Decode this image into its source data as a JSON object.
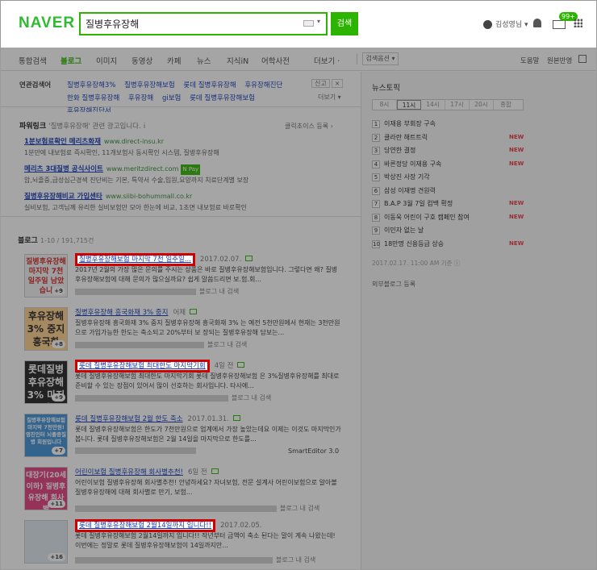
{
  "header": {
    "logo": "NAVER",
    "search_value": "질병후유장해",
    "search_button": "검색",
    "user_name": "김성영님 ▾",
    "mail_badge": "99+"
  },
  "tabs": {
    "items": [
      "통합검색",
      "블로그",
      "이미지",
      "동영상",
      "카페",
      "뉴스",
      "지식iN",
      "어학사전",
      "더보기 ·"
    ],
    "search_options": "검색옵션 ▾",
    "help": "도움말",
    "source_view": "원본반영"
  },
  "related": {
    "label": "연관검색어",
    "links": [
      "질병후유장해3%",
      "질병후유장해보험",
      "롯데 질병후유장해",
      "후유장해진단",
      "한화 질병후유장해",
      "후유장해",
      "gi보험",
      "롯데 질병후유장해보험",
      "후유장해진단서"
    ],
    "report": "신고",
    "close": "×",
    "more": "더보기 ▾"
  },
  "powerlink": {
    "title": "파워링크",
    "query": "'질병후유장해' 관련 광고입니다.",
    "info": "i",
    "register": "클릭초이스 등록 ›",
    "ads": [
      {
        "title": "1분보험료확인 메리츠화재",
        "url": "www.direct-insu.kr",
        "desc": "1분만에 내보험료 즉시확인, 11개보험사 동시확인 시스템, 질병후유장해",
        "npay": ""
      },
      {
        "title": "메리츠 3대질병 공식사이트",
        "url": "www.meritzdirect.com",
        "desc": "암,뇌졸중,급성심근경색 진단비는 기본, 특약서 수술,입원,요양까지 치료단계별 보장",
        "npay": "N Pay"
      },
      {
        "title": "질병후유장해비교 가입센타",
        "url": "www.siibi-bohummall.co.kr",
        "desc": "실비보험, 고객님께 유리한 실비보험만 모아 한눈에 비교, 1초면 내보험료 바로확인",
        "npay": ""
      }
    ]
  },
  "blog": {
    "heading": "블로그",
    "count": "1-10 / 191,715건",
    "items": [
      {
        "title": "질병후유장해보험 마지막 7천 일주일...",
        "date": "2017.02.07.",
        "desc": "2017년 2월의 가장 많은 문의를 주시는 상품은 바로 질병후유장해보험입니다. 그렇다면 왜? 질병후유장해보험에 대해 문의가 많으실까요? 쉽게 말씀드리면 보.험.회...",
        "meta": "블로그 내 검색",
        "thumb_text": "질병후유장해 마지막 7천 일주일 남았습니",
        "thumb_count": "+9",
        "thumb_bg": "#f3f3f3",
        "thumb_color": "#d02020"
      },
      {
        "title": "질병후유장해 흥국화재 3% 중지",
        "date": "어제",
        "desc": "질병후유장해 흥국화재 3% 중지 질병후유장해 흥국화재 3% 는 예전 5천만원에서 현재는 3천만원으로 가입가능한 한도는 축소되고 20%부터 보 장되는 질병후유장해 담보는...",
        "meta": "블로그 내 검색",
        "thumb_text": "후유장해 3% 중지 흥국화",
        "thumb_count": "+8",
        "thumb_bg": "#ffcf8a",
        "thumb_color": "#222"
      },
      {
        "title": "롯데 질병후유장해보험 최대한도 마지막기회",
        "date": "4일 전",
        "desc": "롯데 질병후유장해보험 최대한도 마지막기회 롯데 질병후유장해보험 은 3%질병후유장해를 최대로 준비할 수 있는 장점이 있어서 많이 선호하는 회사입니다. 타사에...",
        "meta": "블로그 내 검색",
        "thumb_text": "롯데질병 후유장해3% 마지막",
        "thumb_count": "+9",
        "thumb_bg": "#1e1e1e",
        "thumb_color": "#fff"
      },
      {
        "title": "롯데 질병후유장해보험 2월 한도 축소",
        "date": "2017.01.31.",
        "desc": "롯데 질병후유장해보험은 한도가 7천만원으로 업계에서 가장 높았는데요 이제는 이것도 마지막인가 봅니다. 롯데 질병후유장해보험은 2월 14일을 마지막으로 한도를...",
        "meta": "SmartEditor 3.0",
        "thumb_text": "질병후유장해보험 마지막 7천만원! 영진인터 뇌졸중질병 회원입니다",
        "thumb_count": "+7",
        "thumb_bg": "#3a8fd8",
        "thumb_color": "#fff"
      },
      {
        "title": "어린이보험 질병후유장해 회사별추천!",
        "date": "6일 전",
        "desc": "어린이보험 질병후유장해 회사별추천! 안녕하세요? 자녀보험, 전문 설계사 어린이보험으로 알아볼 질병후유장해에 대해 회사별로 만기, 보험...",
        "meta": "블로그 내 검색",
        "thumb_text": "대장기(20세이하) 질병후유장해 회사별",
        "thumb_count": "+11",
        "thumb_bg": "#e33a7b",
        "thumb_color": "#fff"
      },
      {
        "title": "롯데 질병후유장해보험 2월14일까지 입니다!!",
        "date": "2017.02.05.",
        "desc": "롯데 질병후유장해보험 2월14일까지 입니다!! 작년부터 금액이 축소 된다는 말이 계속 나왔는데! 이번에는 정말로 롯데 질병후유장해보험이 14일까지만...",
        "meta": "블로그 내 검색",
        "thumb_text": "",
        "thumb_count": "+16",
        "thumb_bg": "#dfe7ee",
        "thumb_color": "#333"
      }
    ]
  },
  "news_topic": {
    "title": "뉴스토픽",
    "times": [
      "8시",
      "11시",
      "14시",
      "17시",
      "20시",
      "종합"
    ],
    "topics": [
      {
        "rank": "1",
        "text": "이재용 부회장 구속",
        "new": ""
      },
      {
        "rank": "2",
        "text": "클라란 해트트릭",
        "new": "NEW"
      },
      {
        "rank": "3",
        "text": "당연한 결정",
        "new": "NEW"
      },
      {
        "rank": "4",
        "text": "바른정당 이재용 구속",
        "new": "NEW"
      },
      {
        "rank": "5",
        "text": "박상진 사장 기각",
        "new": ""
      },
      {
        "rank": "6",
        "text": "삼성 이재명 견원력",
        "new": ""
      },
      {
        "rank": "7",
        "text": "B.A.P 3월 7일 컴백 확정",
        "new": "NEW"
      },
      {
        "rank": "8",
        "text": "이동욱 어린이 구호 캠페인 참여",
        "new": "NEW"
      },
      {
        "rank": "9",
        "text": "이민자 없는 날",
        "new": ""
      },
      {
        "rank": "10",
        "text": "18만명 신용등급 상승",
        "new": "NEW"
      }
    ],
    "time_note": "2017.02.17. 11:00 AM 기준 ⓘ",
    "external_blog": "외부블로그 등록"
  }
}
